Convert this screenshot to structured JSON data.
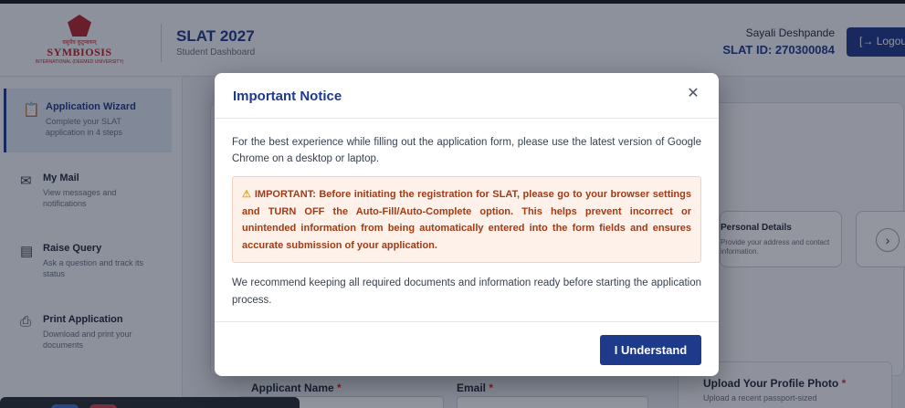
{
  "header": {
    "logo": {
      "tagline": "वसुधैव कुटुम्बकम्",
      "name": "SYMBIOSIS",
      "subtitle": "INTERNATIONAL (DEEMED UNIVERSITY)"
    },
    "app_title": "SLAT 2027",
    "app_subtitle": "Student Dashboard",
    "user_name": "Sayali Deshpande",
    "user_id": "SLAT ID: 270300084",
    "logout_label": "Logout",
    "logout_icon": "logout-icon"
  },
  "sidebar": {
    "items": [
      {
        "title": "Application Wizard",
        "desc": "Complete your SLAT application in 4 steps",
        "icon": "clipboard-icon",
        "active": true
      },
      {
        "title": "My Mail",
        "desc": "View messages and notifications",
        "icon": "mail-icon",
        "active": false
      },
      {
        "title": "Raise Query",
        "desc": "Ask a question and track its status",
        "icon": "chat-icon",
        "active": false
      },
      {
        "title": "Print Application",
        "desc": "Download and print your documents",
        "icon": "printer-icon",
        "active": false
      }
    ]
  },
  "main": {
    "step_card": {
      "title": "Personal Details",
      "desc": "Provide your address and contact information."
    },
    "next_icon": "chevron-right-icon",
    "form": {
      "name_label": "Applicant Name",
      "email_label": "Email",
      "required_mark": "*",
      "upload_title": "Upload Your Profile Photo",
      "upload_desc": "Upload a recent passport-sized"
    }
  },
  "modal": {
    "title": "Important Notice",
    "close_icon": "close-icon",
    "intro": "For the best experience while filling out the application form, please use the latest version of Google Chrome on a desktop or laptop.",
    "warning_icon": "warning-icon",
    "warning": "IMPORTANT: Before initiating the registration for SLAT, please go to your browser settings and TURN OFF the Auto-Fill/Auto-Complete option. This helps prevent incorrect or unintended information from being automatically entered into the form fields and ensures accurate submission of your application.",
    "recommend": "We recommend keeping all required documents and information ready before starting the application process.",
    "button_label": "I Understand"
  },
  "colors": {
    "primary": "#1e3a8a",
    "brand_red": "#b3262d",
    "warning_text": "#a23b14",
    "warning_bg": "#fdf1e9"
  }
}
